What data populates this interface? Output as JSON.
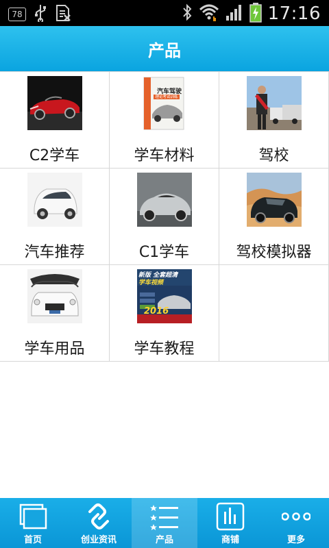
{
  "status_bar": {
    "notification_badge": "78",
    "time": "17:16"
  },
  "header": {
    "title": "产品"
  },
  "products": [
    {
      "label": "C2学车",
      "thumb": "red-convertible-car"
    },
    {
      "label": "学车材料",
      "thumb": "driving-theory-book"
    },
    {
      "label": "驾校",
      "thumb": "driving-school-instructor"
    },
    {
      "label": "汽车推荐",
      "thumb": "white-compact-car"
    },
    {
      "label": "C1学车",
      "thumb": "silver-sports-car"
    },
    {
      "label": "驾校模拟器",
      "thumb": "suv-in-desert"
    },
    {
      "label": "学车用品",
      "thumb": "car-with-sunshade"
    },
    {
      "label": "学车教程",
      "thumb": "driving-video-cover"
    }
  ],
  "thumb_text": {
    "book_title": "汽车驾驶",
    "book_subtitle": "理论考试训练",
    "video_line1": "新版 全套超清",
    "video_line2": "学车视频",
    "video_year": "2016"
  },
  "bottom_nav": [
    {
      "label": "首页",
      "icon": "home-icon",
      "active": false
    },
    {
      "label": "创业资讯",
      "icon": "link-icon",
      "active": false
    },
    {
      "label": "产品",
      "icon": "list-icon",
      "active": true
    },
    {
      "label": "商铺",
      "icon": "store-chart-icon",
      "active": false
    },
    {
      "label": "更多",
      "icon": "more-dots-icon",
      "active": false
    }
  ],
  "colors": {
    "accent": "#0aa4e0",
    "status_bar": "#000000",
    "text": "#1a1a1a",
    "grid_line": "#d6d6d6"
  }
}
